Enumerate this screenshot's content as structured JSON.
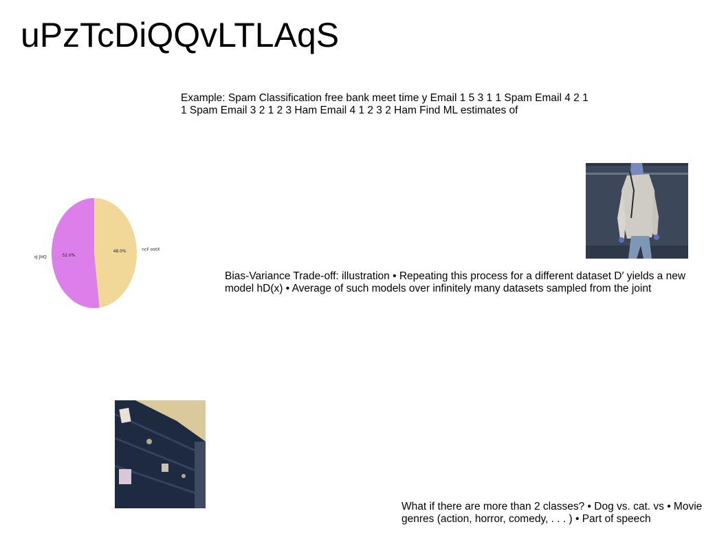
{
  "page": {
    "title": "uPzTcDiQQvLTLAqS"
  },
  "texts": {
    "spam": "Example: Spam Classification free bank meet time y Email 1 5 3 1 1 Spam Email 4 2 1 1 Spam Email 3 2 1 2 3 Ham Email 4 1 2 3 2 Ham Find ML estimates of",
    "bias": "Bias-Variance Trade-off: illustration • Repeating this process for a different dataset D′ yields a new model hD(x) • Average of such models over infinitely many datasets sampled from the joint",
    "multiclass": "What if there are more than 2 classes? • Dog vs. cat. vs • Movie genres (action, horror, comedy, . . . ) • Part of speech"
  },
  "images": {
    "person": "photo-person-standing-by-wall",
    "wall": "photo-weathered-wooden-wall"
  },
  "chart_data": {
    "type": "pie",
    "title": "",
    "slices": [
      {
        "label": "ncF ootX",
        "value": 48.0,
        "display": "48.0%",
        "color": "#f1d898"
      },
      {
        "label": "oJ JHQ",
        "value": 52.0,
        "display": "52.0%",
        "color": "#dd7fea"
      }
    ],
    "start_angle": "top",
    "direction": "clockwise",
    "legend": "none"
  }
}
